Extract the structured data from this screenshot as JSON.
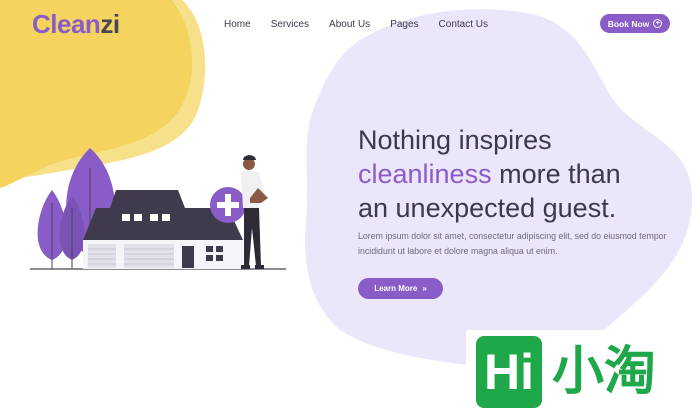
{
  "logo": {
    "part1": "Clean",
    "part2": "zi"
  },
  "nav": {
    "items": [
      {
        "label": "Home"
      },
      {
        "label": "Services"
      },
      {
        "label": "About Us"
      },
      {
        "label": "Pages"
      },
      {
        "label": "Contact Us"
      }
    ]
  },
  "cta": {
    "book_label": "Book Now",
    "book_icon": "plus-circle-icon"
  },
  "hero": {
    "title_line1": "Nothing inspires",
    "title_highlight": "cleanliness",
    "title_line2_rest": " more than",
    "title_line3": "an unexpected guest.",
    "body": "Lorem ipsum dolor sit amet, consectetur adipiscing elit, sed do eiusmod tempor incididunt ut labore et dolore magna aliqua ut enim.",
    "learn_label": "Learn More",
    "learn_icon": "double-chevron-right-icon"
  },
  "watermark": {
    "latin": "Hi",
    "cjk": "小淘"
  },
  "colors": {
    "accent": "#8a5cc7",
    "yellow_blob": "#f4d35e",
    "lavender_blob": "#ece6fb",
    "heading": "#3b3a48"
  }
}
